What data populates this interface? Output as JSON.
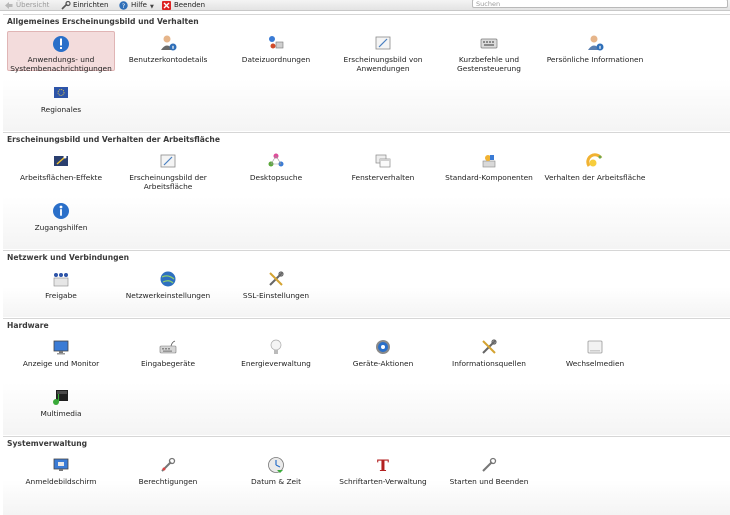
{
  "toolbar": {
    "overview": "Übersicht",
    "configure": "Einrichten",
    "help": "Hilfe",
    "quit": "Beenden",
    "search_placeholder": "Suchen"
  },
  "sections": [
    {
      "title": "Allgemeines Erscheinungsbild und Verhalten",
      "items": [
        {
          "label": "Anwendungs- und Systembenachrichtigungen",
          "icon": "notification-icon"
        },
        {
          "label": "Benutzerkontodetails",
          "icon": "user-account-icon"
        },
        {
          "label": "Dateizuordnungen",
          "icon": "file-associations-icon"
        },
        {
          "label": "Erscheinungsbild von Anwendungen",
          "icon": "application-appearance-icon"
        },
        {
          "label": "Kurzbefehle und Gestensteuerung",
          "icon": "keyboard-shortcuts-icon"
        },
        {
          "label": "Persönliche Informationen",
          "icon": "personal-information-icon"
        },
        {
          "label": "Regionales",
          "icon": "regional-flag-icon"
        }
      ]
    },
    {
      "title": "Erscheinungsbild und Verhalten der Arbeitsfläche",
      "items": [
        {
          "label": "Arbeitsflächen-Effekte",
          "icon": "desktop-effects-icon"
        },
        {
          "label": "Erscheinungsbild der Arbeitsfläche",
          "icon": "workspace-appearance-icon"
        },
        {
          "label": "Desktopsuche",
          "icon": "desktop-search-icon"
        },
        {
          "label": "Fensterverhalten",
          "icon": "window-behavior-icon"
        },
        {
          "label": "Standard-Komponenten",
          "icon": "default-components-icon"
        },
        {
          "label": "Verhalten der Arbeitsfläche",
          "icon": "workspace-behavior-icon"
        },
        {
          "label": "Zugangshilfen",
          "icon": "accessibility-icon"
        }
      ]
    },
    {
      "title": "Netzwerk und Verbindungen",
      "items": [
        {
          "label": "Freigabe",
          "icon": "sharing-icon"
        },
        {
          "label": "Netzwerkeinstellungen",
          "icon": "network-settings-icon"
        },
        {
          "label": "SSL-Einstellungen",
          "icon": "ssl-settings-icon"
        }
      ]
    },
    {
      "title": "Hardware",
      "items": [
        {
          "label": "Anzeige und Monitor",
          "icon": "display-monitor-icon"
        },
        {
          "label": "Eingabegeräte",
          "icon": "input-devices-icon"
        },
        {
          "label": "Energieverwaltung",
          "icon": "power-management-icon"
        },
        {
          "label": "Geräte-Aktionen",
          "icon": "device-actions-icon"
        },
        {
          "label": "Informationsquellen",
          "icon": "information-sources-icon"
        },
        {
          "label": "Wechselmedien",
          "icon": "removable-media-icon"
        },
        {
          "label": "Multimedia",
          "icon": "multimedia-icon"
        }
      ]
    },
    {
      "title": "Systemverwaltung",
      "items": [
        {
          "label": "Anmeldebildschirm",
          "icon": "login-screen-icon"
        },
        {
          "label": "Berechtigungen",
          "icon": "permissions-icon"
        },
        {
          "label": "Datum & Zeit",
          "icon": "date-time-icon"
        },
        {
          "label": "Schriftarten-Verwaltung",
          "icon": "font-management-icon"
        },
        {
          "label": "Starten und Beenden",
          "icon": "startup-shutdown-icon"
        }
      ]
    }
  ]
}
